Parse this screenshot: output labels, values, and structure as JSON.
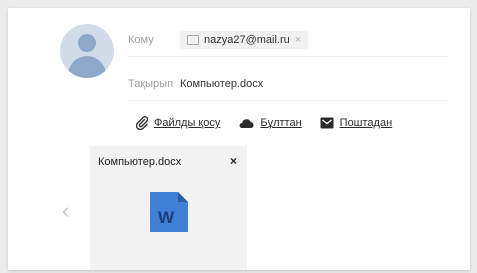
{
  "compose": {
    "to": {
      "label": "Кому",
      "recipient": "nazya27@mail.ru",
      "remove_glyph": "×"
    },
    "subject": {
      "label": "Тақырып",
      "value": "Компьютер.docx"
    }
  },
  "attach_actions": [
    {
      "icon": "paperclip-icon",
      "label": "Файлды қосу"
    },
    {
      "icon": "cloud-icon",
      "label": "Бұлттан"
    },
    {
      "icon": "mail-icon",
      "label": "Поштадан"
    }
  ],
  "attachment": {
    "filename": "Компьютер.docx",
    "close_glyph": "×",
    "file_icon": "word-document-icon",
    "file_icon_letter": "W"
  },
  "nav": {
    "prev_glyph": "‹"
  },
  "colors": {
    "word_blue": "#3f7fd6",
    "word_fold": "#2d5fa8",
    "avatar_bg": "#d2dbe8",
    "avatar_fg": "#8fa8c9"
  }
}
